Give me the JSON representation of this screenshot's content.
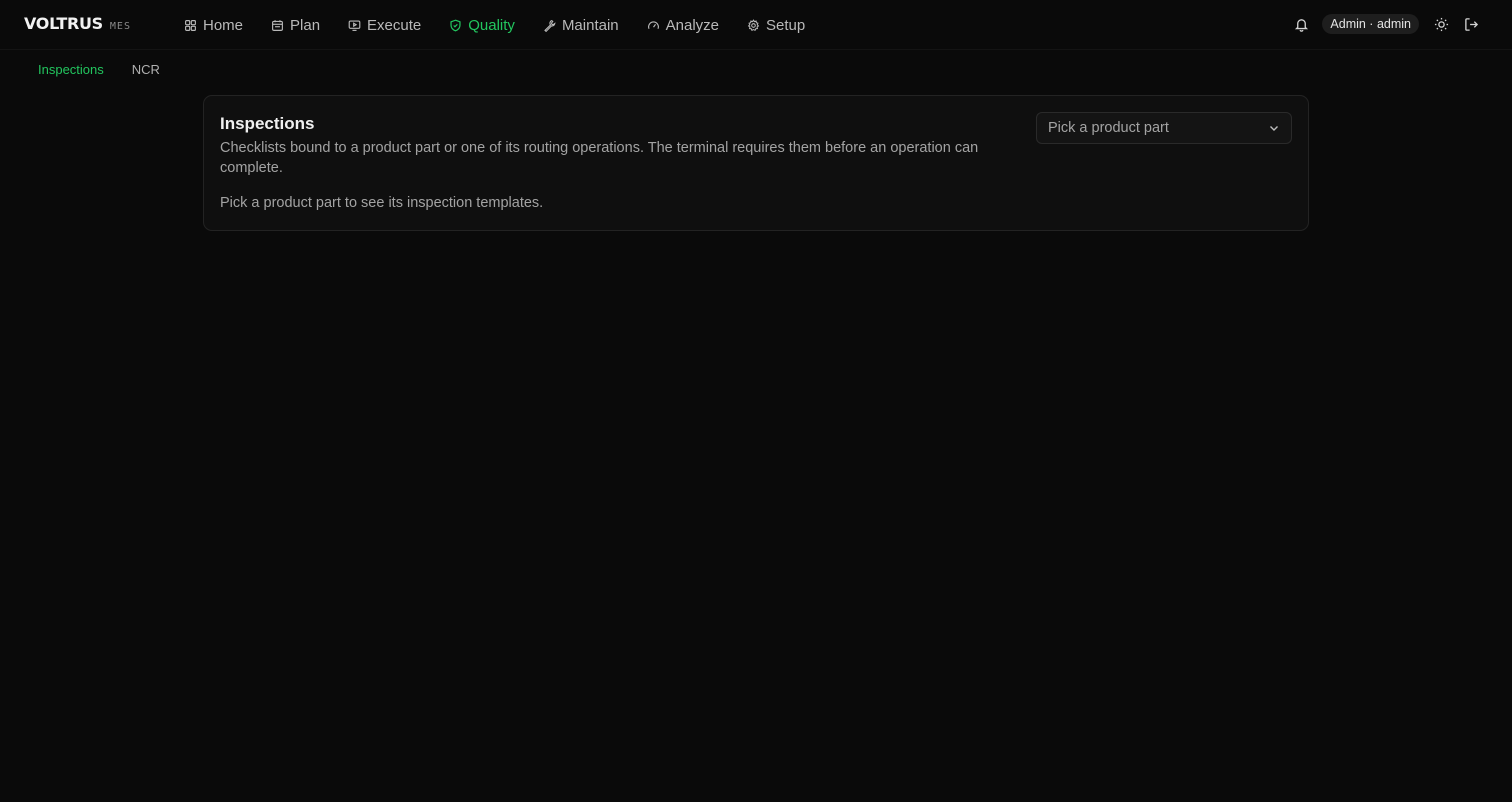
{
  "brand": {
    "name": "VOLTRUS",
    "suffix": "MES"
  },
  "nav": {
    "items": [
      {
        "label": "Home",
        "icon": "grid-icon"
      },
      {
        "label": "Plan",
        "icon": "calendar-icon"
      },
      {
        "label": "Execute",
        "icon": "monitor-play-icon"
      },
      {
        "label": "Quality",
        "icon": "shield-icon",
        "active": true
      },
      {
        "label": "Maintain",
        "icon": "wrench-icon"
      },
      {
        "label": "Analyze",
        "icon": "gauge-icon"
      },
      {
        "label": "Setup",
        "icon": "gear-icon"
      }
    ]
  },
  "user": {
    "label": "Admin · admin"
  },
  "subnav": {
    "items": [
      {
        "label": "Inspections",
        "active": true
      },
      {
        "label": "NCR"
      }
    ]
  },
  "card": {
    "title": "Inspections",
    "description": "Checklists bound to a product part or one of its routing operations. The terminal requires them before an operation can complete.",
    "empty_message": "Pick a product part to see its inspection templates.",
    "select_placeholder": "Pick a product part"
  },
  "colors": {
    "accent": "#22c55e",
    "background": "#0a0a0a",
    "card": "#0f0f0f",
    "border": "#232323"
  }
}
